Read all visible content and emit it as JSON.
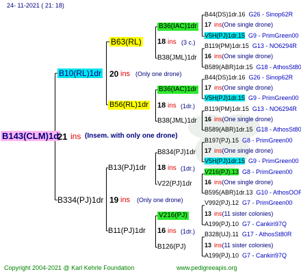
{
  "date": "24- 11-2021 ( 21: 18)",
  "footer": {
    "copyright": "Copyright 2004-2021 @ Karl Kehrle Foundation",
    "url": "www.pedigreeapis.org"
  },
  "colors": {
    "ins": "#e00000",
    "note": "#000080",
    "cyan": "#00e5ee",
    "yellow": "#ffff00",
    "pink": "#ffb6f2",
    "green": "#2ee82e",
    "footer": "#008000",
    "lines": "#000000"
  },
  "root": {
    "label": "B143(CLM)1d",
    "num": "21",
    "ins": "ins",
    "note": "(Insem. with only one drone)"
  },
  "gen1": [
    {
      "label": "B10(RL)1dr",
      "num": "20",
      "ins": "ins",
      "note": "(Only one drone)"
    },
    {
      "label": "B334(PJ)1dr",
      "num": "19",
      "ins": "ins",
      "note": "(Only one drone)"
    }
  ],
  "gen2": [
    {
      "label": "B63(RL)",
      "num": "18",
      "ins": "ins",
      "note": "(3 c.)"
    },
    {
      "label": "B56(RL)1dr",
      "num": "18",
      "ins": "ins",
      "note": "(1dr.)"
    },
    {
      "label": "B13(PJ)1dr",
      "num": "18",
      "ins": "ins",
      "note": "(1dr.)"
    },
    {
      "label": "B11(PJ)1dr",
      "num": "16",
      "ins": "ins",
      "note": "(1dr.)"
    }
  ],
  "gen3": [
    {
      "label": "B36(IAC)1dr"
    },
    {
      "label": "B38(JML)1dr"
    },
    {
      "label": "B36(IAC)1dr"
    },
    {
      "label": "B38(JML)1dr"
    },
    {
      "label": "B834(PJ)1dr",
      "num": "18",
      "ins": "ins",
      "note": "(1dr.)"
    },
    {
      "label": "V22(PJ)1dr"
    },
    {
      "label": "V216(PJ)",
      "num": "13",
      "ins": "ins",
      "note": "(11 sister colonies)"
    },
    {
      "label": "B126(PJ)"
    }
  ],
  "gen4": [
    {
      "name": "B44(DS)1dr.16",
      "code": "G26 - Sinop62R"
    },
    {
      "num": "17",
      "ins": "ins",
      "note": "(One single drone)"
    },
    {
      "name": "V5H(PJ)1dr.15",
      "code": "G9 - PrimGreen00"
    },
    {
      "name": "B119(PM)1dr.15",
      "code": "G13 - NO6294R"
    },
    {
      "num": "16",
      "ins": "ins",
      "note": "(One single drone)"
    },
    {
      "name": "B589(ABR)1dr.15",
      "code": "G18 - AthosSt80R"
    },
    {
      "name": "B44(DS)1dr.16",
      "code": "G26 - Sinop62R"
    },
    {
      "num": "17",
      "ins": "ins",
      "note": "(One single drone)"
    },
    {
      "name": "V5H(PJ)1dr.15",
      "code": "G9 - PrimGreen00"
    },
    {
      "name": "B119(PM)1dr.15",
      "code": "G13 - NO6294R"
    },
    {
      "num": "16",
      "ins": "ins",
      "note": "(One single drone)"
    },
    {
      "name": "B589(ABR)1dr.15",
      "code": "G18 - AthosSt80R"
    },
    {
      "name": "B197(PJ).15",
      "code": "G8 - PrimGreen00"
    },
    {
      "num": "17",
      "ins": "ins",
      "note": "(One single drone)"
    },
    {
      "name": "V5H(PJ)1dr.15",
      "code": "G9 - PrimGreen00"
    },
    {
      "name": "V216(PJ).13",
      "code": "G8 - PrimGreen00"
    },
    {
      "num": "16",
      "ins": "ins",
      "note": "(One single drone)"
    },
    {
      "name": "B595(ABR)1dr.13",
      "code": "G10 - AthosOOR"
    },
    {
      "name": "V992(PJ).12",
      "code": "G7 - PrimGreen00"
    },
    {
      "num": "13",
      "ins": "ins",
      "note": "(11 sister colonies)"
    },
    {
      "name": "A199(PJ).10",
      "code": "G7 - Cankiri97Q"
    },
    {
      "name": "B328(UJ).11",
      "code": "G17 - AthosSt80R"
    },
    {
      "num": "13",
      "ins": "ins",
      "note": "(11 sister colonies)"
    },
    {
      "name": "A199(PJ).10",
      "code": "G7 - Cankiri97Q"
    }
  ]
}
